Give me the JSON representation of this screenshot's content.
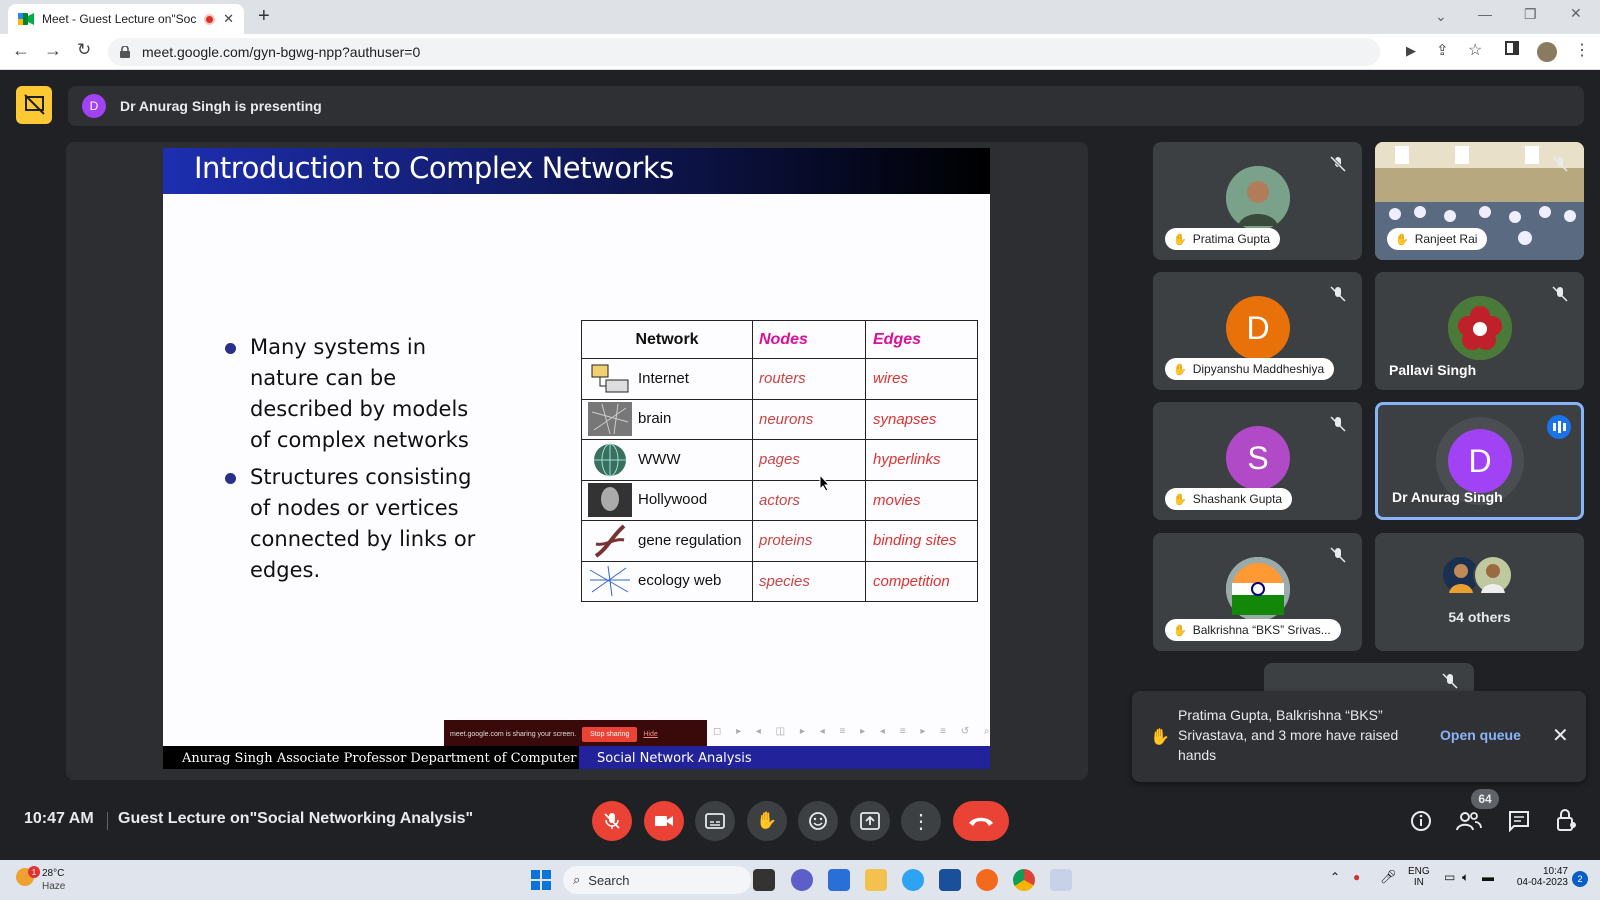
{
  "browser": {
    "tab_title": "Meet - Guest Lecture on\"Soc",
    "new_tab": "+",
    "url": "meet.google.com/gyn-bgwg-npp?authuser=0"
  },
  "presenting": {
    "avatar_letter": "D",
    "text": "Dr Anurag Singh is presenting"
  },
  "slide": {
    "title": "Introduction to Complex Networks",
    "bullets": [
      "Many systems in nature can be described by models of complex networks",
      "Structures consisting of nodes or vertices connected by links or edges."
    ],
    "table": {
      "headers": [
        "Network",
        "Nodes",
        "Edges"
      ],
      "rows": [
        {
          "network": "Internet",
          "nodes": "routers",
          "edges": "wires"
        },
        {
          "network": "brain",
          "nodes": "neurons",
          "edges": "synapses"
        },
        {
          "network": "WWW",
          "nodes": "pages",
          "edges": "hyperlinks"
        },
        {
          "network": "Hollywood",
          "nodes": "actors",
          "edges": "movies"
        },
        {
          "network": "gene regulation",
          "nodes": "proteins",
          "edges": "binding sites"
        },
        {
          "network": "ecology web",
          "nodes": "species",
          "edges": "competition"
        }
      ]
    },
    "footer_left": "Anurag Singh Associate Professor Department of Computer Sc",
    "footer_right": "Social Network Analysis",
    "share_bar": {
      "text": "meet.google.com is sharing your screen.",
      "stop": "Stop sharing",
      "hide": "Hide"
    }
  },
  "participants": [
    {
      "name": "Pratima Gupta",
      "hand": true,
      "muted": true
    },
    {
      "name": "Ranjeet Rai",
      "hand": true,
      "muted": true
    },
    {
      "name": "Dipyanshu Maddheshiya",
      "hand": true,
      "muted": true,
      "letter": "D",
      "color": "#e8710a"
    },
    {
      "name": "Pallavi Singh",
      "hand": false,
      "muted": true
    },
    {
      "name": "Shashank Gupta",
      "hand": true,
      "muted": true,
      "letter": "S",
      "color": "#b04ac6"
    },
    {
      "name": "Dr Anurag Singh",
      "hand": false,
      "muted": false,
      "speaking": true,
      "letter": "D",
      "color": "#a142f4"
    },
    {
      "name": "Balkrishna “BKS” Srivas...",
      "hand": true,
      "muted": true
    },
    {
      "name": "54 others"
    }
  ],
  "toast": {
    "text": "Pratima Gupta, Balkrishna “BKS” Srivastava, and 3 more have raised hands",
    "action": "Open queue"
  },
  "bottom": {
    "time": "10:47 AM",
    "meeting_name": "Guest Lecture on\"Social Networking Analysis\"",
    "people_count": "64"
  },
  "taskbar": {
    "temp": "28°C",
    "weather": "Haze",
    "weather_badge": "1",
    "search": "Search",
    "lang1": "ENG",
    "lang2": "IN",
    "time": "10:47",
    "date": "04-04-2023",
    "notif": "2"
  },
  "colors": {
    "accent": "#8ab4f8",
    "danger": "#ea4335",
    "bg": "#202124"
  }
}
